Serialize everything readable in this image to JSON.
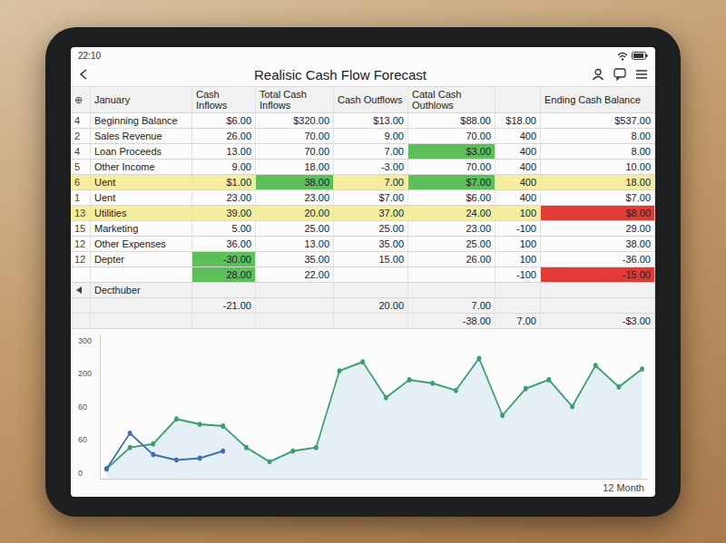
{
  "status_bar": {
    "time": "22:10"
  },
  "title": "Realisic Cash Flow Forecast",
  "table": {
    "corner": "⊕",
    "month": "January",
    "columns": [
      "Cash Inflows",
      "Total Cash Inflows",
      "Cash Outflows",
      "Catal Cash Outhlows",
      "",
      "Ending Cash Balance"
    ],
    "rows": [
      {
        "num": "4",
        "label": "Beginning Balance",
        "highlight": false,
        "cells": [
          {
            "text": "$6.00"
          },
          {
            "text": "$320.00"
          },
          {
            "text": "$13.00"
          },
          {
            "text": "$88.00"
          },
          {
            "text": "$18.00"
          },
          {
            "text": "$537.00"
          }
        ]
      },
      {
        "num": "2",
        "label": "Sales Revenue",
        "highlight": false,
        "cells": [
          {
            "text": "26.00"
          },
          {
            "text": "70.00"
          },
          {
            "text": "9.00"
          },
          {
            "text": "70.00"
          },
          {
            "text": "400"
          },
          {
            "text": "8.00"
          }
        ]
      },
      {
        "num": "4",
        "label": "Loan Proceeds",
        "highlight": false,
        "cells": [
          {
            "text": "13.00"
          },
          {
            "text": "70.00"
          },
          {
            "text": "7.00"
          },
          {
            "text": "$3.00",
            "color": "#5cbf5a"
          },
          {
            "text": "400"
          },
          {
            "text": "8.00"
          }
        ]
      },
      {
        "num": "5",
        "label": "Other Income",
        "highlight": false,
        "cells": [
          {
            "text": "9.00"
          },
          {
            "text": "18.00"
          },
          {
            "text": "-3.00"
          },
          {
            "text": "70.00"
          },
          {
            "text": "400"
          },
          {
            "text": "10.00"
          }
        ]
      },
      {
        "num": "6",
        "label": "Uent",
        "highlight": true,
        "cells": [
          {
            "text": "$1.00"
          },
          {
            "text": "38.00",
            "color": "#5cbf5a"
          },
          {
            "text": "7.00"
          },
          {
            "text": "$7.00",
            "color": "#5cbf5a"
          },
          {
            "text": "400"
          },
          {
            "text": "18.00"
          }
        ]
      },
      {
        "num": "1",
        "label": "Uent",
        "highlight": false,
        "cells": [
          {
            "text": "23.00"
          },
          {
            "text": "23.00"
          },
          {
            "text": "$7.00"
          },
          {
            "text": "$6.00"
          },
          {
            "text": "400"
          },
          {
            "text": "$7.00"
          }
        ]
      },
      {
        "num": "13",
        "label": "Utilities",
        "highlight": true,
        "cells": [
          {
            "text": "39.00"
          },
          {
            "text": "20.00"
          },
          {
            "text": "37.00"
          },
          {
            "text": "24.00"
          },
          {
            "text": "100"
          },
          {
            "text": "$8.00",
            "color": "#e23b35"
          }
        ]
      },
      {
        "num": "15",
        "label": "Marketing",
        "highlight": false,
        "cells": [
          {
            "text": "5.00"
          },
          {
            "text": "25.00"
          },
          {
            "text": "25.00"
          },
          {
            "text": "23.00"
          },
          {
            "text": "-100"
          },
          {
            "text": "29.00"
          }
        ]
      },
      {
        "num": "12",
        "label": "Other Expenses",
        "highlight": false,
        "cells": [
          {
            "text": "36.00"
          },
          {
            "text": "13.00"
          },
          {
            "text": "35.00"
          },
          {
            "text": "25.00"
          },
          {
            "text": "100"
          },
          {
            "text": "38.00"
          }
        ]
      },
      {
        "num": "12",
        "label": "Depter",
        "highlight": false,
        "cells": [
          {
            "text": "-30.00",
            "color": "#5cbf5a"
          },
          {
            "text": "35.00"
          },
          {
            "text": "15.00"
          },
          {
            "text": "26.00"
          },
          {
            "text": "100"
          },
          {
            "text": "-36.00"
          }
        ]
      },
      {
        "num": "",
        "label": "",
        "highlight": false,
        "cells": [
          {
            "text": "28.00",
            "color": "#5cbf5a"
          },
          {
            "text": "22.00"
          },
          {
            "text": ""
          },
          {
            "text": ""
          },
          {
            "text": "-100"
          },
          {
            "text": "-15.00",
            "color": "#e23b35"
          }
        ]
      }
    ]
  },
  "footer": {
    "rows": [
      [
        "Decthuber",
        "",
        "",
        "",
        "",
        "",
        ""
      ],
      [
        "",
        "-21.00",
        "",
        "20.00",
        "7.00",
        "",
        ""
      ],
      [
        "",
        "",
        "",
        "",
        "-38.00",
        "7.00",
        "-$3.00"
      ]
    ]
  },
  "chart": {
    "y_ticks": [
      "300",
      "200",
      "60",
      "60",
      "0"
    ],
    "x_label": "12 Month",
    "series": [
      {
        "color": "#3a9e6e",
        "values": [
          0,
          12,
          14,
          28,
          25,
          24,
          12,
          4,
          10,
          12,
          55,
          60,
          40,
          50,
          48,
          44,
          62,
          30,
          45,
          50,
          35,
          58,
          46,
          56
        ]
      },
      {
        "color": "#3b6fb0",
        "values": [
          0,
          20,
          8,
          5,
          6,
          10
        ]
      }
    ]
  }
}
